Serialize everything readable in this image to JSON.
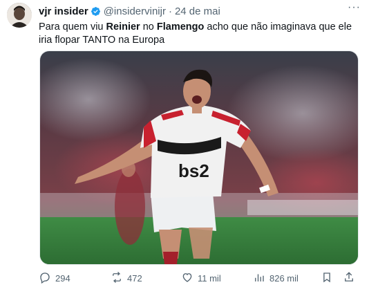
{
  "tweet": {
    "display_name": "vjr insider",
    "handle": "@insidervinijr",
    "separator": "·",
    "date": "24 de mai",
    "more_label": "···",
    "text_parts": {
      "p1": "Para quem viu ",
      "p2": "Reinier",
      "p3": " no ",
      "p4": "Flamengo",
      "p5": " acho que não imaginava que ele iria flopar TANTO na Europa"
    },
    "media": {
      "jersey_text": "bs2"
    },
    "stats": {
      "replies": "294",
      "retweets": "472",
      "likes": "11 mil",
      "views": "826 mil"
    }
  },
  "colors": {
    "text": "#0f1419",
    "muted": "#536471",
    "verified": "#1d9bf0"
  },
  "icons": [
    "verified-icon",
    "more-icon",
    "reply-icon",
    "retweet-icon",
    "like-icon",
    "views-icon",
    "bookmark-icon",
    "share-icon"
  ]
}
